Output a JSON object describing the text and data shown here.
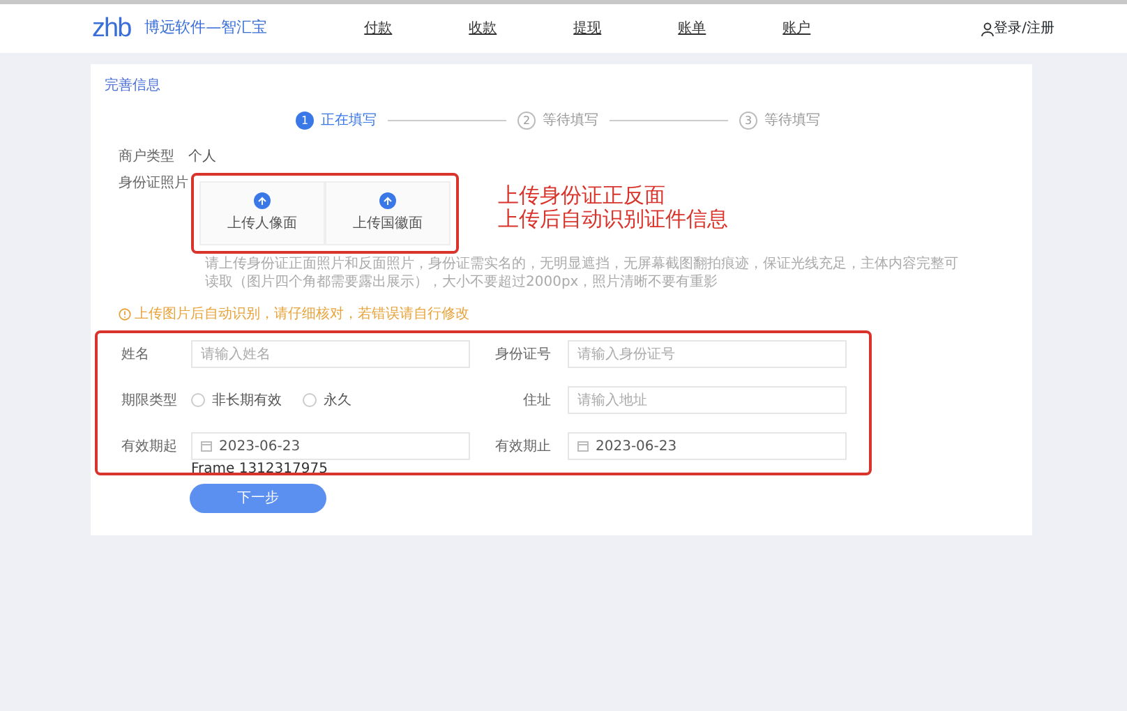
{
  "header": {
    "logo": "zhb",
    "brand": "博远软件—智汇宝",
    "nav": [
      {
        "label": "付款"
      },
      {
        "label": "收款"
      },
      {
        "label": "提现"
      },
      {
        "label": "账单"
      },
      {
        "label": "账户"
      }
    ],
    "login": "登录/注册"
  },
  "card": {
    "title": "完善信息",
    "steps": [
      {
        "number": "1",
        "label": "正在填写",
        "selected": true
      },
      {
        "number": "2",
        "label": "等待填写",
        "selected": false
      },
      {
        "number": "3",
        "label": "等待填写",
        "selected": false
      }
    ],
    "merchant_type": {
      "label": "商户类型",
      "value": "个人"
    },
    "id_photos": {
      "label": "身份证照片",
      "uploads": [
        "上传人像面",
        "上传国徽面"
      ]
    },
    "annotation": [
      "上传身份证正反面",
      "上传后自动识别证件信息"
    ],
    "hint": "请上传身份证正面照片和反面照片，身份证需实名的，无明显遮挡，无屏幕截图翻拍痕迹，保证光线充足，主体内容完整可读取（图片四个角都需要露出展示），大小不要超过2000px，照片清晰不要有重影",
    "warning": "上传图片后自动识别，请仔细核对，若错误请自行修改",
    "fields": [
      {
        "label": "姓名",
        "kind": "input",
        "placeholder": "请输入姓名"
      },
      {
        "label": "身份证号",
        "kind": "input",
        "placeholder": "请输入身份证号"
      },
      {
        "label": "期限类型",
        "kind": "radio",
        "options": [
          {
            "label": "非长期有效",
            "selected": false
          },
          {
            "label": "永久",
            "selected": false
          }
        ]
      },
      {
        "label": "住址",
        "kind": "input",
        "placeholder": "请输入地址"
      },
      {
        "label": "有效期起",
        "kind": "date",
        "value": "2023-06-23"
      },
      {
        "label": "有效期止",
        "kind": "date",
        "value": "2023-06-23"
      }
    ],
    "frame_label": "Frame 1312317975",
    "next_button": "下一步"
  }
}
